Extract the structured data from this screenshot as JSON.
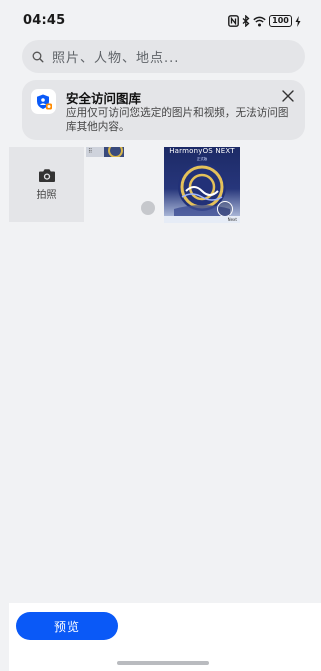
{
  "status_bar": {
    "time": "04:45",
    "battery": "100",
    "icons": [
      "nfc-icon",
      "bluetooth-icon",
      "wifi-icon",
      "battery-icon",
      "charging-icon"
    ]
  },
  "search": {
    "placeholder": "照片、人物、地点..."
  },
  "banner": {
    "title": "安全访问图库",
    "text": "应用仅可访问您选定的图片和视频，无法访问图库其他内容。",
    "icon": "shield-icon"
  },
  "camera_tile": {
    "label": "拍照",
    "icon": "camera-icon"
  },
  "poster": {
    "title": "HarmonyOS NEXT",
    "subtitle": "正式版",
    "badge": "Next"
  },
  "footer": {
    "preview_label": "预览"
  },
  "colors": {
    "accent": "#0a59f7",
    "background": "#f1f2f4",
    "card": "#e4e5e8"
  }
}
